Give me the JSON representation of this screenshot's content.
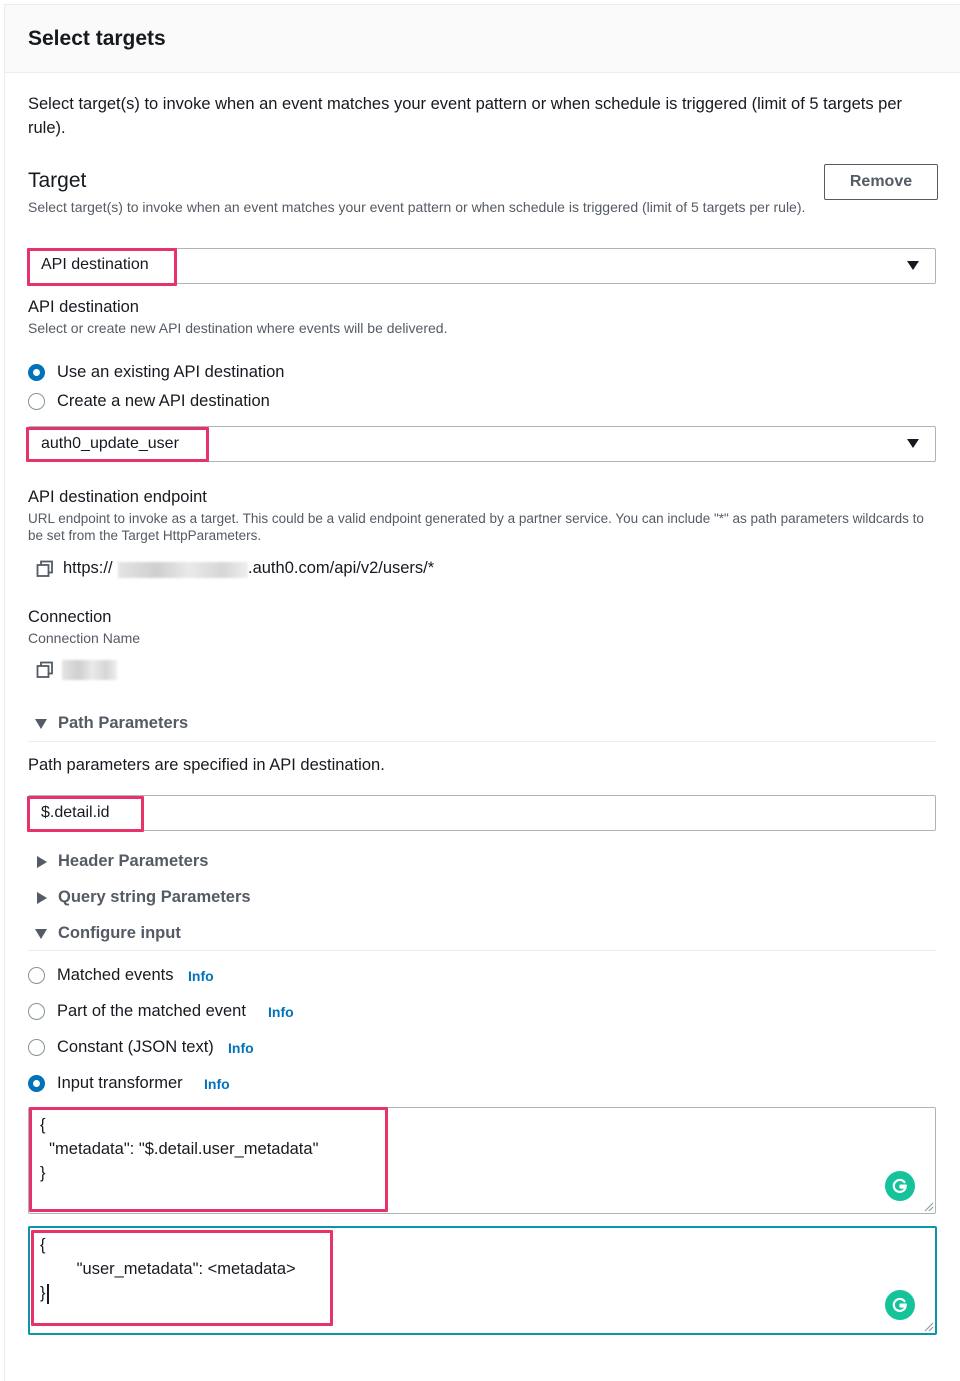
{
  "header": {
    "title": "Select targets"
  },
  "intro": "Select target(s) to invoke when an event matches your event pattern or when schedule is triggered (limit of 5 targets per rule).",
  "target": {
    "title": "Target",
    "description": "Select target(s) to invoke when an event matches your event pattern or when schedule is triggered (limit of 5 targets per rule).",
    "remove_label": "Remove",
    "type_value": "API destination"
  },
  "api_destination": {
    "label": "API destination",
    "description": "Select or create new API destination where events will be delivered.",
    "options": [
      "Use an existing API destination",
      "Create a new API destination"
    ],
    "selected_option": 0,
    "destination_value": "auth0_update_user"
  },
  "endpoint": {
    "label": "API destination endpoint",
    "description": "URL endpoint to invoke as a target. This could be a valid endpoint generated by a partner service. You can include \"*\" as path parameters wildcards to be set from the Target HttpParameters.",
    "url_prefix": "https://",
    "url_suffix": ".auth0.com/api/v2/users/*"
  },
  "connection": {
    "label": "Connection",
    "sublabel": "Connection Name"
  },
  "path_parameters": {
    "title": "Path Parameters",
    "note": "Path parameters are specified in API destination.",
    "value": "$.detail.id"
  },
  "collapsed_sections": [
    "Header Parameters",
    "Query string Parameters"
  ],
  "configure_input": {
    "title": "Configure input",
    "info_label": "Info",
    "options": [
      "Matched events",
      "Part of the matched event",
      "Constant (JSON text)",
      "Input transformer"
    ],
    "selected_option": 3,
    "input_path": [
      "{",
      "  \"metadata\": \"$.detail.user_metadata\"",
      "}"
    ],
    "input_template": [
      "{",
      "        \"user_metadata\": <metadata>",
      "}"
    ]
  },
  "colors": {
    "highlight": "#e8326a",
    "primary": "#0073bb",
    "grammarly": "#15c39a",
    "focus_border": "#0a95a8"
  }
}
